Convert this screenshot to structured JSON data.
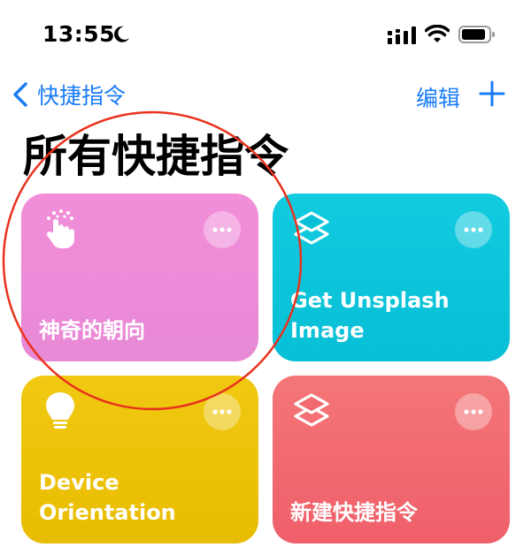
{
  "status_bar": {
    "time": "13:55",
    "moon_icon": "moon-icon",
    "signal_icon": "cellular-signal-icon",
    "wifi_icon": "wifi-icon",
    "battery_icon": "battery-icon"
  },
  "nav": {
    "back_label": "快捷指令",
    "edit_label": "编辑",
    "accent_color": "#1a7cf5"
  },
  "page": {
    "title": "所有快捷指令"
  },
  "shortcuts": [
    {
      "title": "神奇的朝向",
      "icon": "hand-tap-icon",
      "color": "#ee8cd8"
    },
    {
      "title_line1": "Get Unsplash",
      "title_line2": "Image",
      "icon": "layers-icon",
      "color": "#0cc5da"
    },
    {
      "title_line1": "Device",
      "title_line2": "Orientation",
      "icon": "lightbulb-icon",
      "color": "#ecc20a"
    },
    {
      "title": "新建快捷指令",
      "icon": "layers-icon",
      "color": "#f16a70"
    }
  ],
  "annotation": {
    "shape": "circle",
    "color": "#e8321e"
  }
}
